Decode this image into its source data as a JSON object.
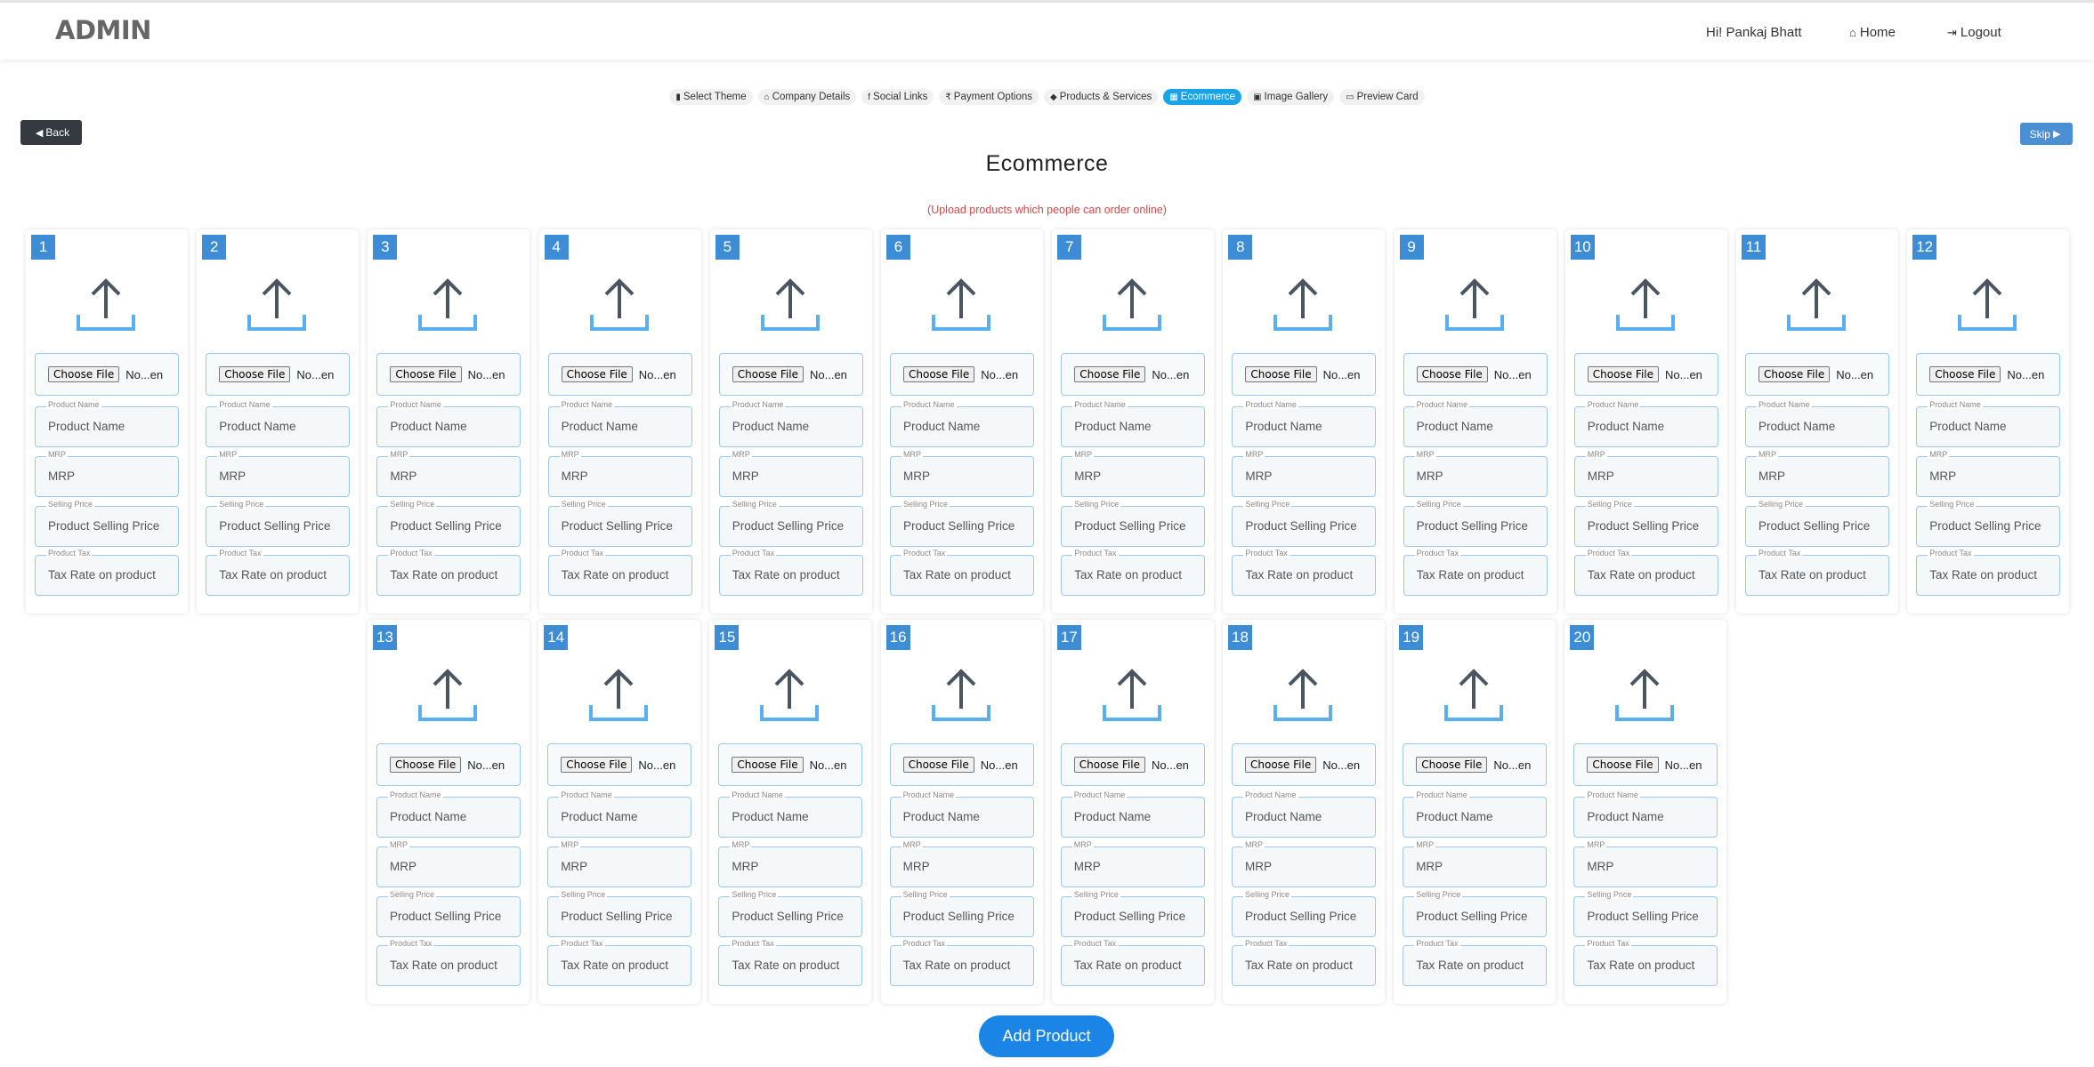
{
  "header": {
    "brand": "ADMIN",
    "greeting": "Hi! Pankaj Bhatt",
    "home": "Home",
    "logout": "Logout"
  },
  "steps": [
    {
      "icon": "book-icon",
      "glyph": "▮",
      "label": "Select Theme"
    },
    {
      "icon": "bank-icon",
      "glyph": "⌂",
      "label": "Company Details"
    },
    {
      "icon": "facebook-icon",
      "glyph": "f",
      "label": "Social Links"
    },
    {
      "icon": "rupee-icon",
      "glyph": "₹",
      "label": "Payment Options"
    },
    {
      "icon": "tag-icon",
      "glyph": "◆",
      "label": "Products & Services"
    },
    {
      "icon": "cart-icon",
      "glyph": "▦",
      "label": "Ecommerce",
      "active": true
    },
    {
      "icon": "image-icon",
      "glyph": "▣",
      "label": "Image Gallery"
    },
    {
      "icon": "laptop-icon",
      "glyph": "▭",
      "label": "Preview Card"
    }
  ],
  "back_label": "Back",
  "skip_label": "Skip",
  "title": "Ecommerce",
  "subtitle": "(Upload products which people can order online)",
  "product_form": {
    "choose_file": "Choose File",
    "file_status": "No...en",
    "name_label": "Product Name",
    "name_placeholder": "Product Name",
    "mrp_label": "MRP",
    "mrp_placeholder": "MRP",
    "price_label": "Selling Price",
    "price_placeholder": "Product Selling Price",
    "tax_label": "Product Tax",
    "tax_placeholder": "Tax Rate on product"
  },
  "cards": [
    "1",
    "2",
    "3",
    "4",
    "5",
    "6",
    "7",
    "8",
    "9",
    "10",
    "11",
    "12",
    "13",
    "14",
    "15",
    "16",
    "17",
    "18",
    "19",
    "20"
  ],
  "add_product_label": "Add Product",
  "colors": {
    "accent": "#1aa3e8",
    "badge": "#3d8dd6",
    "add_button": "#1a85e6",
    "back_button": "#343a40",
    "subtitle": "#d34848"
  }
}
